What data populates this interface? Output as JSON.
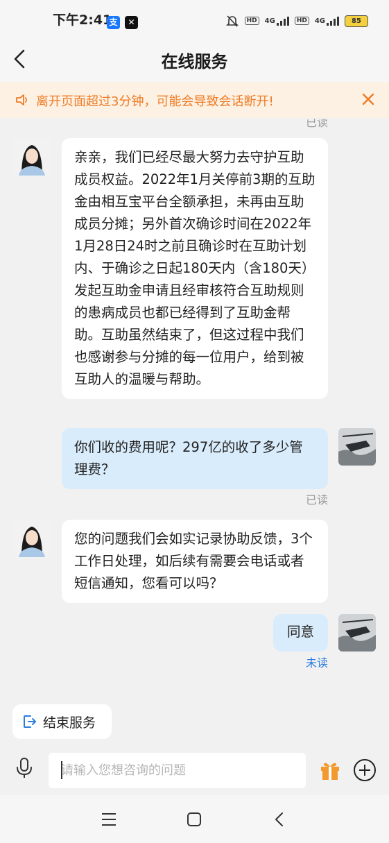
{
  "status_bar": {
    "time": "下午2:41",
    "app_icons": [
      "alipay-icon",
      "capcut-icon"
    ],
    "network_label": "4G",
    "hd_label": "HD",
    "battery": "85",
    "battery_color": "#f4d03f"
  },
  "header": {
    "title": "在线服务",
    "back_icon": "back-chevron-icon"
  },
  "notice": {
    "text": "离开页面超过3分钟，可能会导致会话断开!",
    "color": "#ee7b24",
    "background": "#fdf1e3"
  },
  "chat": {
    "partial_status": "已读",
    "messages": [
      {
        "sender": "agent",
        "text": "亲亲，我们已经尽最大努力去守护互助成员权益。2022年1月关停前3期的互助金由相互宝平台全额承担，未再由互助成员分摊；另外首次确诊时间在2022年1月28日24时之前且确诊时在互助计划内、于确诊之日起180天内（含180天）发起互助金申请且经审核符合互助规则的患病成员也都已经得到了互助金帮助。互助虽然结束了，但这过程中我们也感谢参与分摊的每一位用户，给到被互助人的温暖与帮助。"
      },
      {
        "sender": "user",
        "text": "你们收的费用呢？297亿的收了多少管理费？",
        "status": "已读"
      },
      {
        "sender": "agent",
        "text": "您的问题我们会如实记录协助反馈，3个工作日处理，如后续有需要会电话或者短信通知，您看可以吗？"
      },
      {
        "sender": "user",
        "text": "同意",
        "status": "未读",
        "status_color": "#2b7de0"
      }
    ]
  },
  "actions": {
    "end_service_label": "结束服务"
  },
  "input": {
    "placeholder": "请输入您想咨询的问题",
    "value": ""
  },
  "colors": {
    "agent_bubble": "#ffffff",
    "user_bubble": "#d9ecfb",
    "read_status": "#9a9a9a",
    "accent_blue": "#2b7de0",
    "gift": "#f29a2e"
  }
}
